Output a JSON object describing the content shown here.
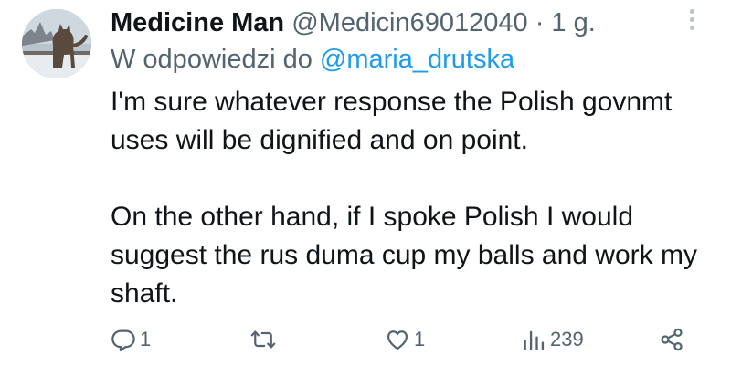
{
  "tweet": {
    "author_name": "Medicine Man",
    "author_handle": "@Medicin69012040",
    "separator": "·",
    "time": "1 g.",
    "reply_prefix": "W odpowiedzi do ",
    "reply_to": "@maria_drutska",
    "text_paragraphs": [
      "I'm sure whatever response the Polish govnmt uses will be dignified and on point.",
      "On the other hand, if I spoke Polish I would suggest the rus duma cup my balls and work my shaft."
    ]
  },
  "actions": {
    "reply": {
      "icon": "reply-icon",
      "count": "1"
    },
    "retweet": {
      "icon": "retweet-icon",
      "count": ""
    },
    "like": {
      "icon": "heart-icon",
      "count": "1"
    },
    "views": {
      "icon": "views-icon",
      "count": "239"
    },
    "share": {
      "icon": "share-icon"
    }
  },
  "colors": {
    "text": "#0f1419",
    "secondary": "#536471",
    "link": "#1d9bf0",
    "more_dots": "#b8c1c9"
  }
}
